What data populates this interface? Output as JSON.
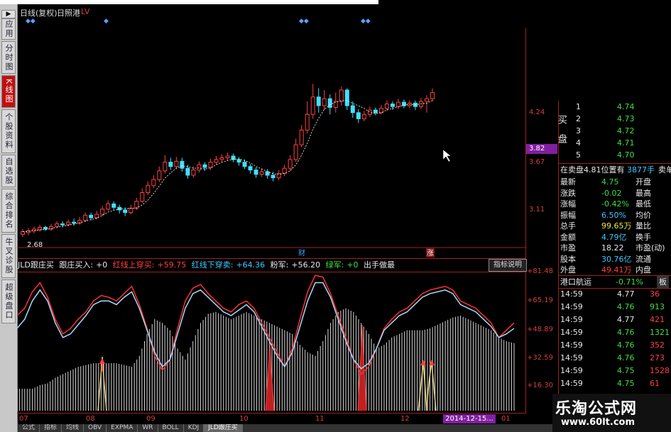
{
  "left_tabs": [
    "应用",
    "分时图",
    "K线图",
    "个股资料",
    "自选股",
    "综合排名",
    "牛叉诊股",
    "超级盘口"
  ],
  "left_tab_active": 2,
  "chart_header": {
    "title": "日线(复权)",
    "overlay": "日照港",
    "extra": "LV"
  },
  "price_axis": {
    "labels": [
      "4.24",
      "3.67",
      "3.11"
    ],
    "current": "3.82"
  },
  "price_chart": {
    "low_label": "2.68",
    "events": {
      "cai": "财",
      "zhang": "涨"
    },
    "candles": [
      [
        2.72,
        2.75,
        2.69,
        2.78
      ],
      [
        2.74,
        2.76,
        2.71,
        2.79
      ],
      [
        2.76,
        2.78,
        2.73,
        2.81
      ],
      [
        2.77,
        2.8,
        2.75,
        2.83
      ],
      [
        2.8,
        2.78,
        2.76,
        2.82
      ],
      [
        2.78,
        2.81,
        2.76,
        2.84
      ],
      [
        2.81,
        2.84,
        2.79,
        2.87
      ],
      [
        2.84,
        2.83,
        2.8,
        2.87
      ],
      [
        2.83,
        2.86,
        2.81,
        2.89
      ],
      [
        2.86,
        2.85,
        2.82,
        2.9
      ],
      [
        2.85,
        2.88,
        2.83,
        2.92
      ],
      [
        2.88,
        2.94,
        2.86,
        2.97
      ],
      [
        2.94,
        2.91,
        2.88,
        2.97
      ],
      [
        2.91,
        2.95,
        2.89,
        2.99
      ],
      [
        2.95,
        3.01,
        2.93,
        3.05
      ],
      [
        3.01,
        3.07,
        2.99,
        3.11
      ],
      [
        3.07,
        3.03,
        3.0,
        3.1
      ],
      [
        3.03,
        3.0,
        2.96,
        3.06
      ],
      [
        3.0,
        2.97,
        2.93,
        3.03
      ],
      [
        2.97,
        3.02,
        2.95,
        3.06
      ],
      [
        3.02,
        3.1,
        3.0,
        3.14
      ],
      [
        3.1,
        3.2,
        3.08,
        3.25
      ],
      [
        3.2,
        3.28,
        3.17,
        3.33
      ],
      [
        3.28,
        3.35,
        3.25,
        3.4
      ],
      [
        3.35,
        3.45,
        3.32,
        3.5
      ],
      [
        3.45,
        3.55,
        3.42,
        3.63
      ],
      [
        3.55,
        3.5,
        3.46,
        3.6
      ],
      [
        3.5,
        3.56,
        3.47,
        3.61
      ],
      [
        3.56,
        3.48,
        3.44,
        3.6
      ],
      [
        3.48,
        3.4,
        3.36,
        3.52
      ],
      [
        3.4,
        3.46,
        3.37,
        3.5
      ],
      [
        3.46,
        3.52,
        3.43,
        3.56
      ],
      [
        3.52,
        3.49,
        3.45,
        3.55
      ],
      [
        3.49,
        3.55,
        3.46,
        3.59
      ],
      [
        3.55,
        3.58,
        3.52,
        3.62
      ],
      [
        3.58,
        3.6,
        3.55,
        3.64
      ],
      [
        3.6,
        3.62,
        3.57,
        3.66
      ],
      [
        3.62,
        3.58,
        3.55,
        3.65
      ],
      [
        3.58,
        3.55,
        3.51,
        3.61
      ],
      [
        3.55,
        3.5,
        3.47,
        3.58
      ],
      [
        3.5,
        3.46,
        3.42,
        3.53
      ],
      [
        3.46,
        3.41,
        3.37,
        3.49
      ],
      [
        3.41,
        3.44,
        3.38,
        3.48
      ],
      [
        3.44,
        3.4,
        3.36,
        3.47
      ],
      [
        3.4,
        3.37,
        3.33,
        3.44
      ],
      [
        3.37,
        3.42,
        3.34,
        3.46
      ],
      [
        3.42,
        3.48,
        3.39,
        3.52
      ],
      [
        3.48,
        3.58,
        3.45,
        3.63
      ],
      [
        3.58,
        3.75,
        3.55,
        3.82
      ],
      [
        3.75,
        3.92,
        3.72,
        3.98
      ],
      [
        3.92,
        4.1,
        3.88,
        4.25
      ],
      [
        4.1,
        4.3,
        4.05,
        4.45
      ],
      [
        4.3,
        4.2,
        4.12,
        4.4
      ],
      [
        4.2,
        4.28,
        4.15,
        4.38
      ],
      [
        4.28,
        4.18,
        4.1,
        4.33
      ],
      [
        4.18,
        4.25,
        4.12,
        4.35
      ],
      [
        4.25,
        4.38,
        4.2,
        4.42
      ],
      [
        4.38,
        4.2,
        4.15,
        4.4
      ],
      [
        4.2,
        4.12,
        4.06,
        4.25
      ],
      [
        4.12,
        4.05,
        4.0,
        4.16
      ],
      [
        4.05,
        4.1,
        4.02,
        4.14
      ],
      [
        4.1,
        4.15,
        4.07,
        4.19
      ],
      [
        4.15,
        4.12,
        4.09,
        4.18
      ],
      [
        4.12,
        4.17,
        4.1,
        4.21
      ],
      [
        4.17,
        4.22,
        4.14,
        4.26
      ],
      [
        4.22,
        4.19,
        4.15,
        4.25
      ],
      [
        4.19,
        4.24,
        4.16,
        4.28
      ],
      [
        4.24,
        4.2,
        4.17,
        4.27
      ],
      [
        4.2,
        4.23,
        4.17,
        4.26
      ],
      [
        4.23,
        4.19,
        4.15,
        4.26
      ],
      [
        4.19,
        4.25,
        4.16,
        4.29
      ],
      [
        4.25,
        4.28,
        4.12,
        4.32
      ],
      [
        4.28,
        4.35,
        4.25,
        4.4
      ]
    ]
  },
  "indicator_bar": {
    "name": "JLD跟庄买",
    "items": [
      {
        "label": "跟庄买入:",
        "value": "+0",
        "color": "#e8e8e8"
      },
      {
        "label": "红线上穿买:",
        "value": "+59.75",
        "color": "#ff4040"
      },
      {
        "label": "红线下穿卖:",
        "value": "+64.36",
        "color": "#40c8ff"
      },
      {
        "label": "粉军:",
        "value": "+56.20",
        "color": "#e8e8e8"
      },
      {
        "label": "绿军:",
        "value": "+0",
        "color": "#3ce03c"
      },
      {
        "label": "出手做最",
        "value": "",
        "color": "#e8e8e8"
      }
    ],
    "help_button": "指标说明"
  },
  "indicator_axis": {
    "labels": [
      "+81.48",
      "+65.19",
      "+48.89",
      "+32.59",
      "+16.30"
    ]
  },
  "indicator": {
    "red_line": [
      62,
      66,
      75,
      80,
      72,
      60,
      52,
      55,
      60,
      64,
      70,
      73,
      72,
      70,
      74,
      78,
      68,
      55,
      40,
      32,
      38,
      55,
      70,
      77,
      79,
      74,
      70,
      66,
      64,
      68,
      70,
      66,
      58,
      50,
      42,
      34,
      44,
      60,
      75,
      84,
      83,
      74,
      62,
      50,
      38,
      30,
      34,
      44,
      55,
      60,
      64,
      66,
      70,
      74,
      76,
      77,
      78,
      76,
      70,
      68,
      66,
      62,
      58,
      50,
      54,
      58
    ],
    "blue_line": [
      55,
      60,
      70,
      76,
      70,
      58,
      50,
      52,
      57,
      62,
      68,
      70,
      70,
      68,
      72,
      75,
      66,
      54,
      42,
      34,
      38,
      52,
      66,
      74,
      76,
      72,
      68,
      64,
      62,
      65,
      68,
      64,
      56,
      48,
      40,
      34,
      42,
      56,
      70,
      80,
      80,
      72,
      60,
      48,
      38,
      33,
      36,
      44,
      54,
      58,
      62,
      64,
      68,
      72,
      74,
      75,
      76,
      74,
      68,
      66,
      64,
      60,
      56,
      50,
      52,
      55
    ],
    "bars": [
      22,
      22,
      22,
      24,
      25,
      28,
      30,
      32,
      34,
      35,
      36,
      36,
      36,
      36,
      35,
      34,
      40,
      52,
      60,
      58,
      54,
      44,
      38,
      48,
      58,
      63,
      64,
      62,
      60,
      62,
      64,
      62,
      60,
      58,
      56,
      54,
      52,
      46,
      42,
      40,
      48,
      58,
      64,
      66,
      64,
      58,
      52,
      44,
      46,
      50,
      52,
      54,
      54,
      54,
      55,
      57,
      59,
      61,
      62,
      60,
      58,
      56,
      54,
      50,
      48,
      47
    ]
  },
  "date_axis": {
    "labels": [
      "07",
      "08",
      "09",
      "10",
      "11",
      "12",
      "01"
    ],
    "cursor_date": "2014-12-15..."
  },
  "right_panel": {
    "buy_label": "买盘",
    "buys": [
      {
        "n": "1",
        "p": "4.74"
      },
      {
        "n": "2",
        "p": "4.73"
      },
      {
        "n": "3",
        "p": "4.72"
      },
      {
        "n": "4",
        "p": "4.71"
      },
      {
        "n": "5",
        "p": "4.70"
      }
    ],
    "order_line": {
      "left": "在卖盘4.81位置有",
      "right": "3877手",
      "end": "卖单"
    },
    "quote_rows": [
      {
        "k1": "最新",
        "v1": "4.75",
        "c1": "green",
        "k2": "开盘"
      },
      {
        "k1": "涨跌",
        "v1": "-0.02",
        "c1": "green",
        "k2": "最高"
      },
      {
        "k1": "涨幅",
        "v1": "-0.42%",
        "c1": "green",
        "k2": "最低"
      },
      {
        "k1": "振幅",
        "v1": "6.50%",
        "c1": "cyan",
        "k2": "均价"
      },
      {
        "k1": "总手",
        "v1": "99.65万",
        "c1": "yellow",
        "k2": "量比"
      },
      {
        "k1": "金额",
        "v1": "4.79亿",
        "c1": "cyan",
        "k2": "换手"
      },
      {
        "k1": "市盈",
        "v1": "18.22",
        "c1": "white",
        "k2": "市盈(动)"
      },
      {
        "k1": "股本",
        "v1": "30.76亿",
        "c1": "cyan",
        "k2": "流通"
      },
      {
        "k1": "外盘",
        "v1": "49.41万",
        "c1": "red",
        "k2": "内盘"
      }
    ],
    "stock": {
      "name": "港口航运",
      "change": "-0.71%",
      "btn": "板"
    },
    "trades": [
      {
        "t": "14:59",
        "p": "4.77",
        "v": "36",
        "pc": "white",
        "vc": "red"
      },
      {
        "t": "14:59",
        "p": "4.76",
        "v": "913",
        "pc": "green",
        "vc": "green"
      },
      {
        "t": "14:59",
        "p": "4.77",
        "v": "421",
        "pc": "white",
        "vc": "red"
      },
      {
        "t": "14:59",
        "p": "4.76",
        "v": "1321",
        "pc": "green",
        "vc": "green"
      },
      {
        "t": "14:59",
        "p": "4.76",
        "v": "352",
        "pc": "green",
        "vc": "red"
      },
      {
        "t": "14:59",
        "p": "4.76",
        "v": "273",
        "pc": "green",
        "vc": "red"
      },
      {
        "t": "14:59",
        "p": "4.75",
        "v": "1528",
        "pc": "green",
        "vc": "red"
      },
      {
        "t": "14:59",
        "p": "4.75",
        "v": "61",
        "pc": "green",
        "vc": "red"
      }
    ]
  },
  "watermark": {
    "line1": "乐淘公式网",
    "line2": "www.60lt.com"
  },
  "bottom_tabs": [
    "公式",
    "指标",
    "均线",
    "OBV",
    "EXPMA",
    "WR",
    "BOLL",
    "KDJ",
    "JLD跟庄买"
  ],
  "colors": {
    "up": "#ff4040",
    "down": "#40e0ff",
    "axis": "#a02020",
    "ma": "#ffffff"
  }
}
